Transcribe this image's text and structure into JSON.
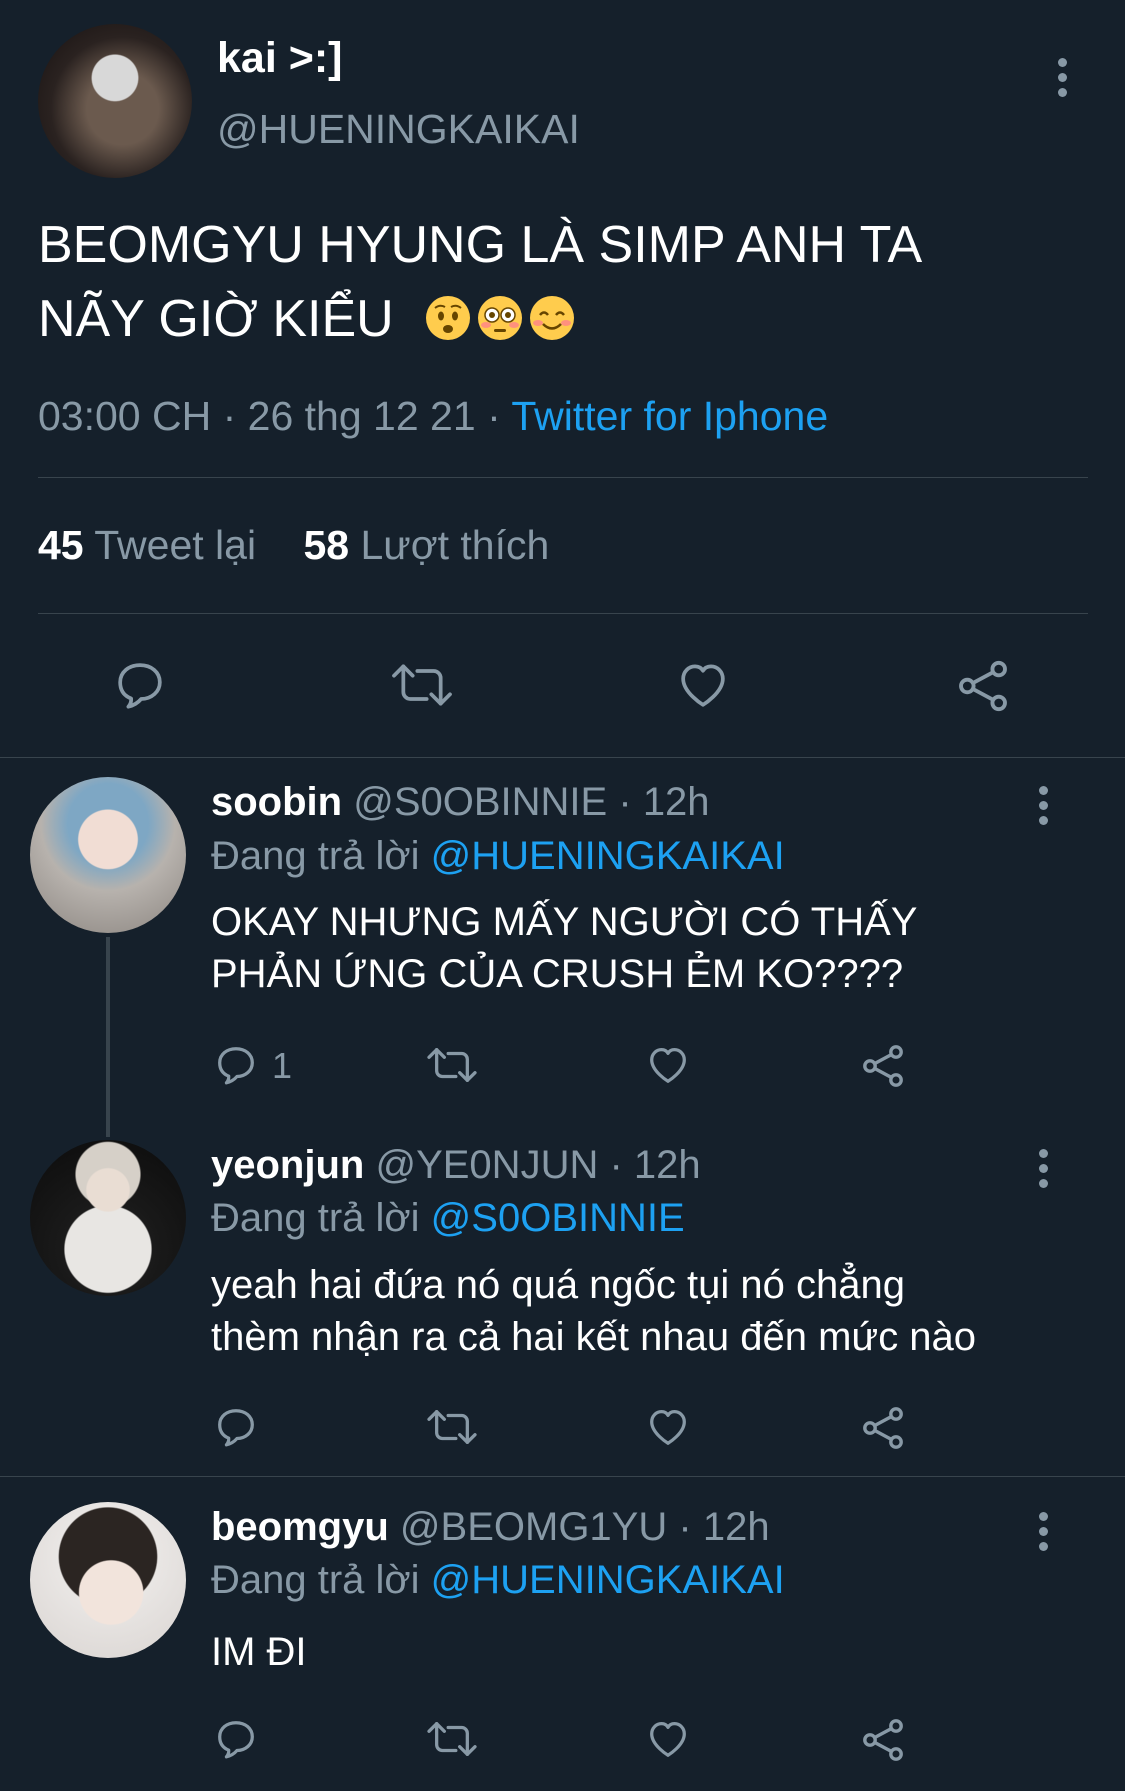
{
  "main_tweet": {
    "display_name": "kai >:]",
    "handle": "@HUENINGKAIKAI",
    "text_line1": "BEOMGYU HYUNG LÀ SIMP ANH TA",
    "text_line2": "NÃY GIỜ KIỂU",
    "emojis": [
      "worried-face",
      "flushed-face",
      "smiling-face"
    ],
    "time": "03:00 CH",
    "date": "26 thg 12 21",
    "source": "Twitter for Iphone",
    "retweets_count": "45",
    "retweets_label": "Tweet lại",
    "likes_count": "58",
    "likes_label": "Lượt thích"
  },
  "replies": [
    {
      "display_name": "soobin",
      "handle": "@S0OBINNIE",
      "time": "12h",
      "replying_label": "Đang trả lời",
      "replying_to": "@HUENINGKAIKAI",
      "text_line1": "OKAY NHƯNG MẤY NGƯỜI CÓ THẤY",
      "text_line2": "PHẢN ỨNG CỦA CRUSH ẺM KO????",
      "reply_count": "1"
    },
    {
      "display_name": "yeonjun",
      "handle": "@YE0NJUN",
      "time": "12h",
      "replying_label": "Đang trả lời",
      "replying_to": "@S0OBINNIE",
      "text_line1": "yeah hai đứa nó quá ngốc tụi nó chẳng",
      "text_line2": "thèm nhận ra cả hai kết nhau đến mức nào",
      "reply_count": ""
    },
    {
      "display_name": "beomgyu",
      "handle": "@BEOMG1YU",
      "time": "12h",
      "replying_label": "Đang trả lời",
      "replying_to": "@HUENINGKAIKAI",
      "text_line1": "IM ĐI",
      "text_line2": "",
      "reply_count": ""
    }
  ],
  "colors": {
    "background": "#15202b",
    "muted": "#8899a6",
    "accent": "#1da1f2",
    "divider": "#38444d"
  },
  "icons": [
    "reply-icon",
    "retweet-icon",
    "like-icon",
    "share-icon",
    "more-icon"
  ]
}
